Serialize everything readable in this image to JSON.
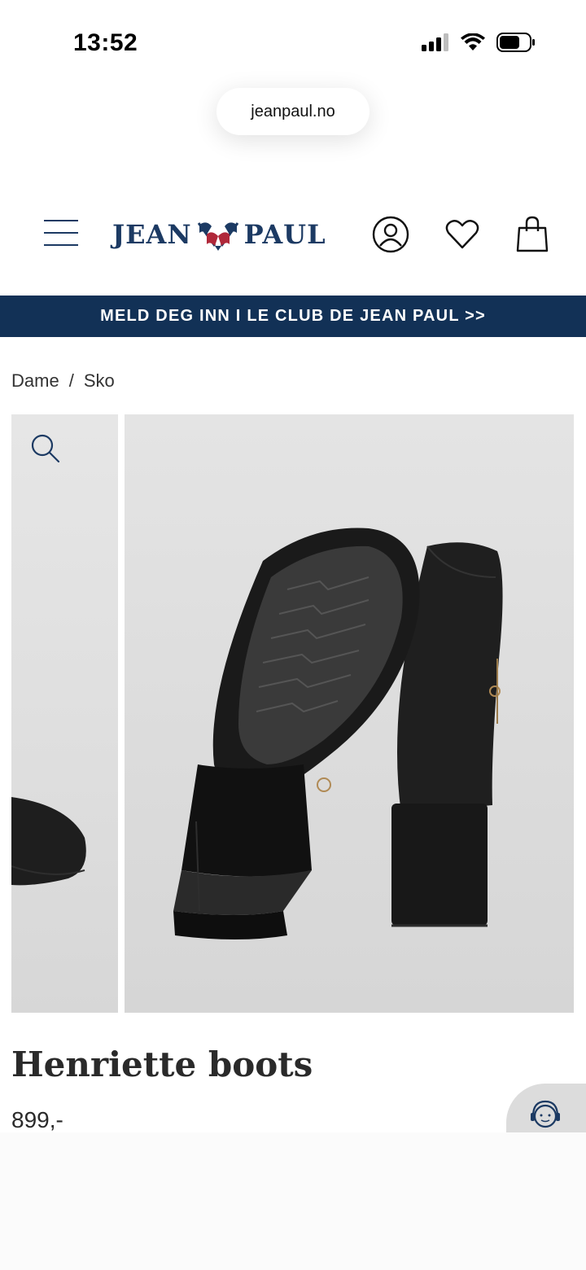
{
  "status_bar": {
    "time": "13:52"
  },
  "browser": {
    "url": "jeanpaul.no"
  },
  "header": {
    "logo_left": "JEAN",
    "logo_right": "PAUL",
    "menu_icon": "hamburger-menu-icon",
    "account_icon": "user-icon",
    "wishlist_icon": "heart-icon",
    "cart_icon": "shopping-bag-icon"
  },
  "promo": {
    "text": "MELD DEG INN I LE CLUB DE JEAN PAUL >>",
    "bg_color": "#123156"
  },
  "breadcrumb": {
    "items": [
      "Dame",
      "Sko"
    ],
    "separator": "/"
  },
  "product": {
    "name": "Henriette boots",
    "price": "899,-"
  },
  "colors": {
    "brand_navy": "#1c3a63",
    "flag_red": "#b0283a"
  }
}
